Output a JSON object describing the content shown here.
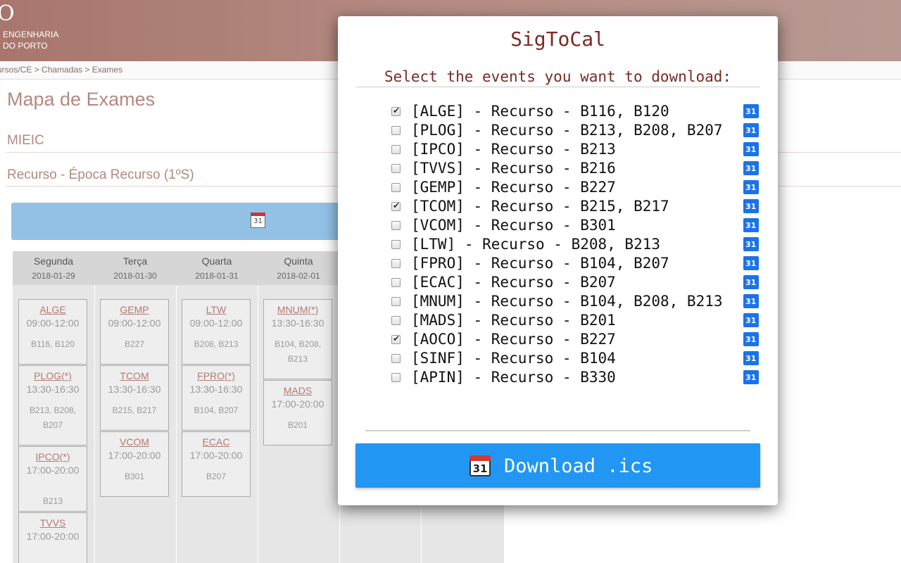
{
  "header": {
    "logo_mark": "O",
    "line1": "ENGENHARIA",
    "line2": "DO PORTO"
  },
  "breadcrumb": "ursos/CE > Chamadas > Exames",
  "page": {
    "title": "Mapa de Exames",
    "course": "MIEIC",
    "season": "Recurso - Época Recurso (1ºS)",
    "banner_icon": "calendar-icon",
    "banner_icon_text": "31"
  },
  "days": [
    {
      "name": "Segunda",
      "date": "2018-01-29"
    },
    {
      "name": "Terça",
      "date": "2018-01-30"
    },
    {
      "name": "Quarta",
      "date": "2018-01-31"
    },
    {
      "name": "Quinta",
      "date": "2018-02-01"
    }
  ],
  "exams": {
    "mon": [
      {
        "code": "ALGE",
        "star": "",
        "time": "09:00-12:00",
        "rooms": "B116, B120"
      },
      {
        "code": "PLOG",
        "star": "(*)",
        "time": "13:30-16:30",
        "rooms": "B213, B208, B207"
      },
      {
        "code": "IPCO",
        "star": "(*)",
        "time": "17:00-20:00",
        "rooms": "B213"
      },
      {
        "code": "TVVS",
        "star": "",
        "time": "17:00-20:00",
        "rooms": ""
      }
    ],
    "tue": [
      {
        "code": "GEMP",
        "star": "",
        "time": "09:00-12:00",
        "rooms": "B227"
      },
      {
        "code": "TCOM",
        "star": "",
        "time": "13:30-16:30",
        "rooms": "B215, B217"
      },
      {
        "code": "VCOM",
        "star": "",
        "time": "17:00-20:00",
        "rooms": "B301"
      }
    ],
    "wed": [
      {
        "code": "LTW",
        "star": "",
        "time": "09:00-12:00",
        "rooms": "B208, B213"
      },
      {
        "code": "FPRO",
        "star": "(*)",
        "time": "13:30-16:30",
        "rooms": "B104, B207"
      },
      {
        "code": "ECAC",
        "star": "",
        "time": "17:00-20:00",
        "rooms": "B207"
      }
    ],
    "thu": [
      {
        "code": "MNUM",
        "star": "(*)",
        "time": "13:30-16:30",
        "rooms": "B104, B208, B213"
      },
      {
        "code": "MADS",
        "star": "",
        "time": "17:00-20:00",
        "rooms": "B201"
      }
    ]
  },
  "modal": {
    "title": "SigToCal",
    "subtitle": "Select the events you want to download:",
    "events": [
      {
        "label": "[ALGE] - Recurso - B116, B120",
        "checked": true
      },
      {
        "label": "[PLOG] - Recurso - B213, B208, B207",
        "checked": false
      },
      {
        "label": "[IPCO] - Recurso - B213",
        "checked": false
      },
      {
        "label": "[TVVS] - Recurso - B216",
        "checked": false
      },
      {
        "label": "[GEMP] - Recurso - B227",
        "checked": false
      },
      {
        "label": "[TCOM] - Recurso - B215, B217",
        "checked": true
      },
      {
        "label": "[VCOM] - Recurso - B301",
        "checked": false
      },
      {
        "label": "[LTW] - Recurso - B208, B213",
        "checked": false
      },
      {
        "label": "[FPRO] - Recurso - B104, B207",
        "checked": false
      },
      {
        "label": "[ECAC] - Recurso - B207",
        "checked": false
      },
      {
        "label": "[MNUM] - Recurso - B104, B208, B213",
        "checked": false
      },
      {
        "label": "[MADS] - Recurso - B201",
        "checked": false
      },
      {
        "label": "[AOCO] - Recurso - B227",
        "checked": true
      },
      {
        "label": "[SINF] - Recurso - B104",
        "checked": false
      },
      {
        "label": "[APIN] - Recurso - B330",
        "checked": false
      }
    ],
    "event_icon": "google-calendar-icon",
    "event_icon_text": "31",
    "download_icon": "calendar-icon",
    "download_icon_text": "31",
    "download_label": "Download .ics"
  },
  "colors": {
    "header": "#a8766d",
    "accent_text": "#b58780",
    "modal_title": "#7a2a22",
    "button": "#2196f3",
    "banner": "#93c1e6"
  }
}
